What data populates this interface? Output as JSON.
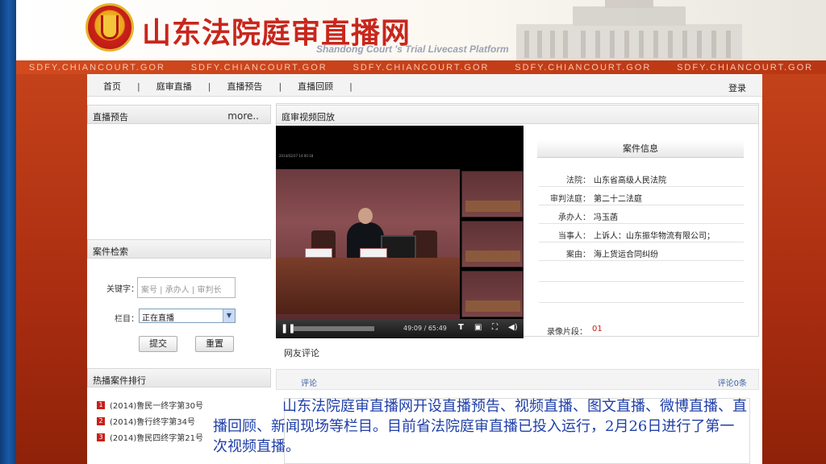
{
  "header": {
    "site_title": "山东法院庭审直播网",
    "site_subtitle": "Shandong Court 's Trial Livecast Platform"
  },
  "domain_strip": [
    "SDFY.CHIANCOURT.GOR",
    "SDFY.CHIANCOURT.GOR",
    "SDFY.CHIANCOURT.GOR",
    "SDFY.CHIANCOURT.GOR",
    "SDFY.CHIANCOURT.GOR"
  ],
  "nav": {
    "items": [
      "首页",
      "庭审直播",
      "直播预告",
      "直播回顾"
    ],
    "separator": "|",
    "login": "登录"
  },
  "live_preview": {
    "title": "直播预告",
    "more": "more.."
  },
  "case_search": {
    "title": "案件检索",
    "keyword_label": "关键字：",
    "keyword_placeholder": "案号 | 承办人 | 审判长",
    "column_label": "栏目：",
    "column_value": "正在直播",
    "submit": "提交",
    "reset": "重置"
  },
  "hot_cases": {
    "title": "热播案件排行",
    "items": [
      {
        "rank": "1",
        "text": "(2014)鲁民一终字第30号"
      },
      {
        "rank": "2",
        "text": "(2014)鲁行终字第34号"
      },
      {
        "rank": "3",
        "text": "(2014)鲁民四终字第21号"
      }
    ]
  },
  "video_panel": {
    "title": "庭审视频回放",
    "player": {
      "time": "49:09 / 65:49",
      "controls": [
        "pause-icon",
        "text-icon",
        "window-icon",
        "fullscreen-icon",
        "volume-icon"
      ]
    }
  },
  "case_info": {
    "title": "案件信息",
    "rows": [
      {
        "key": "法院：",
        "value": "山东省高级人民法院"
      },
      {
        "key": "审判法庭：",
        "value": "第二十二法庭"
      },
      {
        "key": "承办人：",
        "value": "冯玉菡"
      },
      {
        "key": "当事人：",
        "value": "上诉人：山东振华物流有限公司；"
      },
      {
        "key": "案由：",
        "value": "海上货运合同纠纷"
      },
      {
        "key": "",
        "value": ""
      },
      {
        "key": "",
        "value": ""
      }
    ],
    "segment_label": "录像片段：",
    "segment_value": "01"
  },
  "comments": {
    "title": "网友评论",
    "label": "评论",
    "count": "评论0条"
  },
  "caption": "山东法院庭审直播网开设直播预告、视频直播、图文直播、微博直播、直播回顾、新闻现场等栏目。目前省法院庭审直播已投入运行，2月26日进行了第一次视频直播。",
  "colors": {
    "brand_red": "#c8261c",
    "frame_blue": "#1a5aa8",
    "caption_blue": "#1f3fa8"
  }
}
